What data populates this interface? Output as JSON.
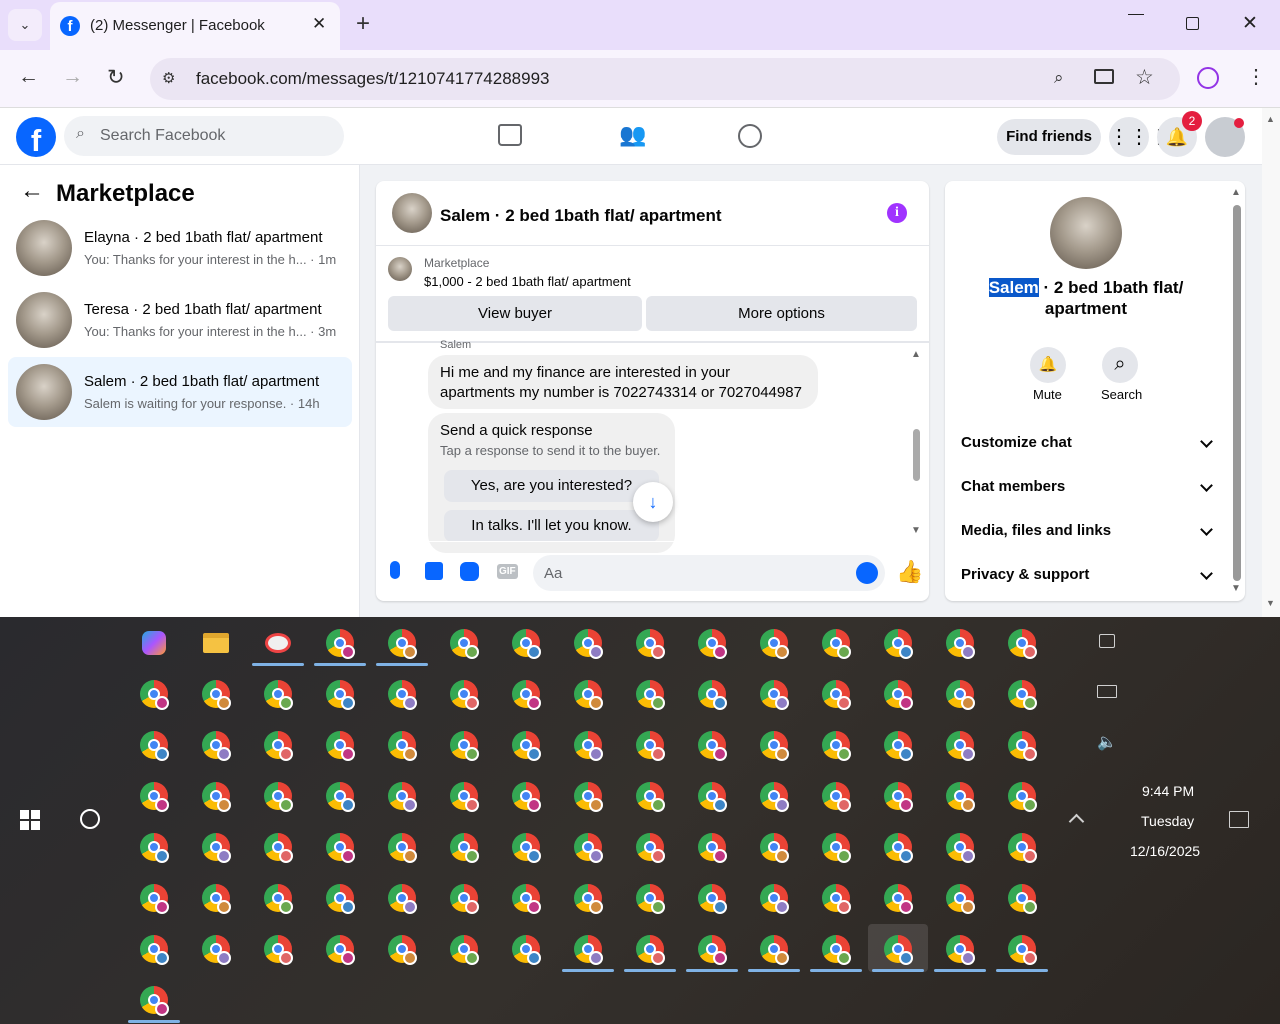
{
  "browser": {
    "tab_title": "(2) Messenger | Facebook",
    "url": "facebook.com/messages/t/1210741774288993"
  },
  "facebook": {
    "search_placeholder": "Search Facebook",
    "find_friends": "Find friends",
    "notif_count": "2"
  },
  "sidebar": {
    "title": "Marketplace",
    "conversations": [
      {
        "title": "Elayna · 2 bed 1bath flat/ apartment",
        "snippet": "You: Thanks for your interest in the h... · 1m"
      },
      {
        "title": "Teresa · 2 bed 1bath flat/ apartment",
        "snippet": "You: Thanks for your interest in the h... · 3m"
      },
      {
        "title": "Salem · 2 bed 1bath flat/ apartment",
        "snippet": "Salem is waiting for your response. · 14h"
      }
    ]
  },
  "chat": {
    "title": "Salem · 2 bed 1bath flat/ apartment",
    "listing_label": "Marketplace",
    "listing_detail": "$1,000 - 2 bed 1bath flat/ apartment",
    "view_buyer": "View buyer",
    "more_options": "More options",
    "sender": "Salem",
    "message_line1": "Hi me and my finance are interested in your",
    "message_line2": "apartments my number is 7022743314 or 7027044987",
    "quick_title": "Send a quick response",
    "quick_sub": "Tap a response to send it to the buyer.",
    "quick_options": [
      "Yes, are you interested?",
      "In talks. I'll let you know."
    ],
    "composer_placeholder": "Aa",
    "gif": "GIF"
  },
  "info": {
    "name_highlight": "Salem",
    "name_rest1": " · 2 bed 1bath flat/",
    "name_rest2": "apartment",
    "mute": "Mute",
    "search": "Search",
    "sections": [
      "Customize chat",
      "Chat members",
      "Media, files and links",
      "Privacy & support"
    ]
  },
  "taskbar": {
    "time": "9:44 PM",
    "day": "Tuesday",
    "date": "12/16/2025"
  },
  "colors": {
    "facebook_blue": "#0866ff",
    "messenger_purple": "#a033ff",
    "notif_red": "#e41e3f",
    "selected_bg": "#ebf5ff"
  }
}
